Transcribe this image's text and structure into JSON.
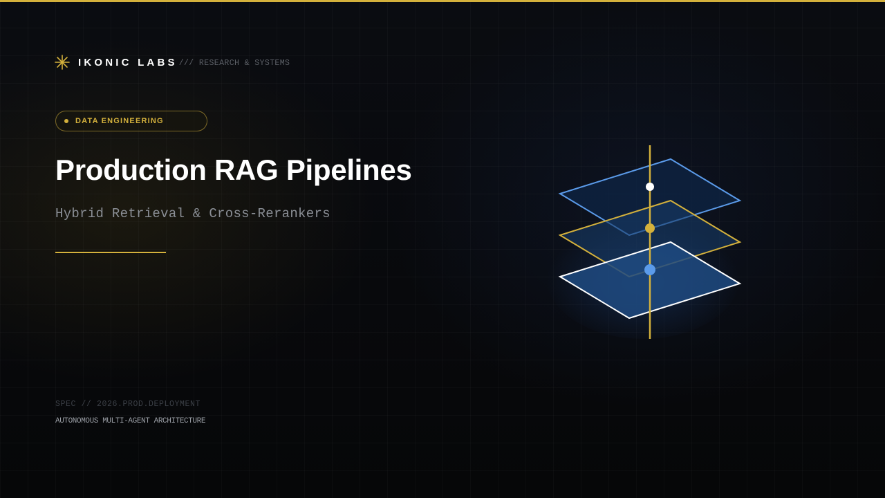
{
  "brand": {
    "name": "IKONIC LABS",
    "tagline": "/// RESEARCH & SYSTEMS",
    "icon": "asterisk-star-icon"
  },
  "badge": {
    "label": "DATA ENGINEERING"
  },
  "title": "Production RAG Pipelines",
  "subtitle": "Hybrid Retrieval & Cross-Rerankers",
  "footer": {
    "spec": "SPEC // 2026.PROD.DEPLOYMENT",
    "description": "AUTONOMOUS MULTI-AGENT ARCHITECTURE"
  },
  "illustration": {
    "icon": "stacked-layers-icon",
    "layers": [
      {
        "name": "top",
        "stroke": "#5b9bea",
        "node": "#ffffff"
      },
      {
        "name": "middle",
        "stroke": "#d4b13c",
        "node": "#d4b13c"
      },
      {
        "name": "bottom",
        "stroke": "#ffffff",
        "node": "#5b9bea"
      }
    ],
    "axis_color": "#d4b13c"
  },
  "colors": {
    "accent": "#d4b13c",
    "blue": "#5b9bea",
    "background": "#08090c"
  }
}
